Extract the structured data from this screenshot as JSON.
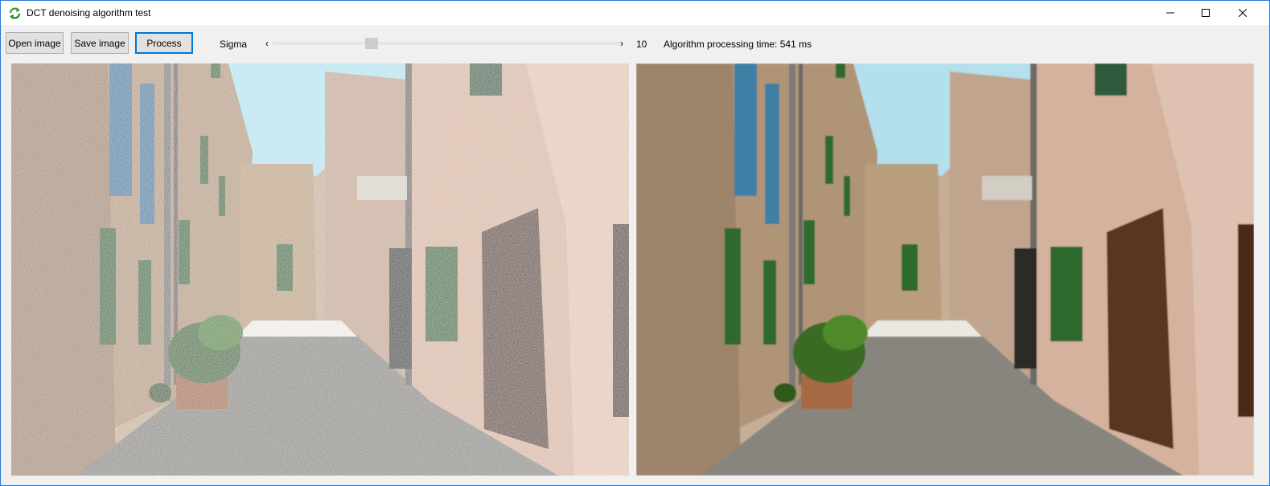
{
  "window": {
    "title": "DCT denoising algorithm test"
  },
  "toolbar": {
    "open_label": "Open image",
    "save_label": "Save image",
    "process_label": "Process",
    "sigma_label": "Sigma",
    "sigma_value": "10",
    "time_text": "Algorithm processing time: 541 ms"
  },
  "colors": {
    "accent": "#0078d7",
    "shutter_green": "#2e6b2e",
    "shutter_blue": "#3f7fa5",
    "sky": "#b7e3ef",
    "wall_warm": "#b89c80",
    "wall_pink": "#d9b8a4",
    "door_brown": "#5a3420",
    "pavement": "#8d8a85"
  },
  "images": [
    {
      "role": "original",
      "noisy": true
    },
    {
      "role": "processed",
      "noisy": false
    }
  ]
}
